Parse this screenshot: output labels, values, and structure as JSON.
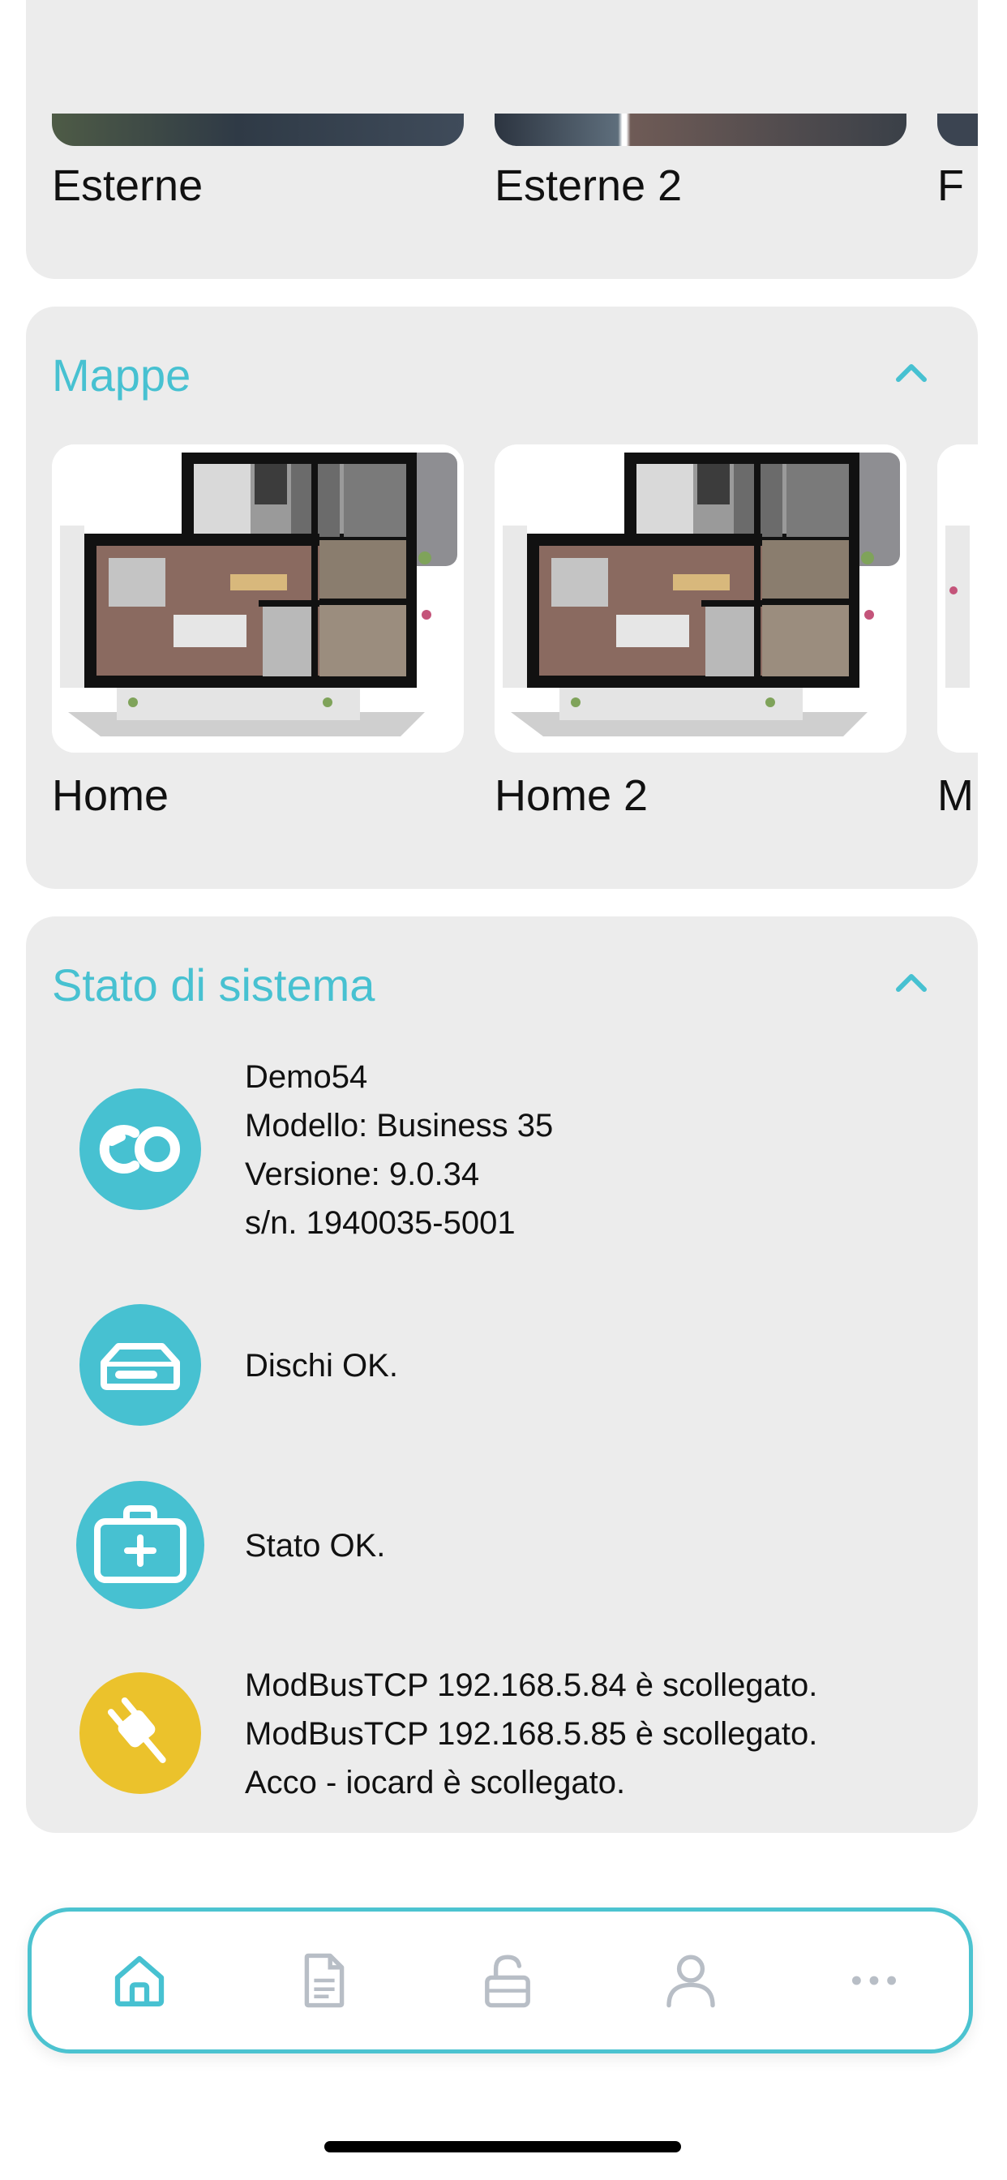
{
  "cameras": {
    "items": [
      {
        "label": "Esterne"
      },
      {
        "label": "Esterne 2"
      },
      {
        "label": "F"
      }
    ]
  },
  "maps": {
    "title": "Mappe",
    "items": [
      {
        "label": "Home"
      },
      {
        "label": "Home 2"
      },
      {
        "label": "M"
      }
    ]
  },
  "system": {
    "title": "Stato di sistema",
    "device": {
      "name": "Demo54",
      "model": "Modello: Business 35",
      "version": "Versione: 9.0.34",
      "serial": "s/n. 1940035-5001"
    },
    "disks": "Dischi OK.",
    "status": "Stato OK.",
    "connections": [
      "ModBusTCP 192.168.5.84 è scollegato.",
      "ModBusTCP 192.168.5.85 è scollegato.",
      "Acco - iocard è scollegato."
    ]
  },
  "tabbar": {
    "items": [
      {
        "name": "home",
        "icon": "home-icon",
        "active": true
      },
      {
        "name": "document",
        "icon": "document-icon",
        "active": false
      },
      {
        "name": "lock",
        "icon": "lock-open-icon",
        "active": false
      },
      {
        "name": "user",
        "icon": "user-icon",
        "active": false
      },
      {
        "name": "more",
        "icon": "more-icon",
        "active": false
      }
    ]
  },
  "colors": {
    "accent": "#47c1d1",
    "card": "#ececec",
    "warning": "#ebc22c",
    "inactive_icon": "#b8bec6"
  }
}
